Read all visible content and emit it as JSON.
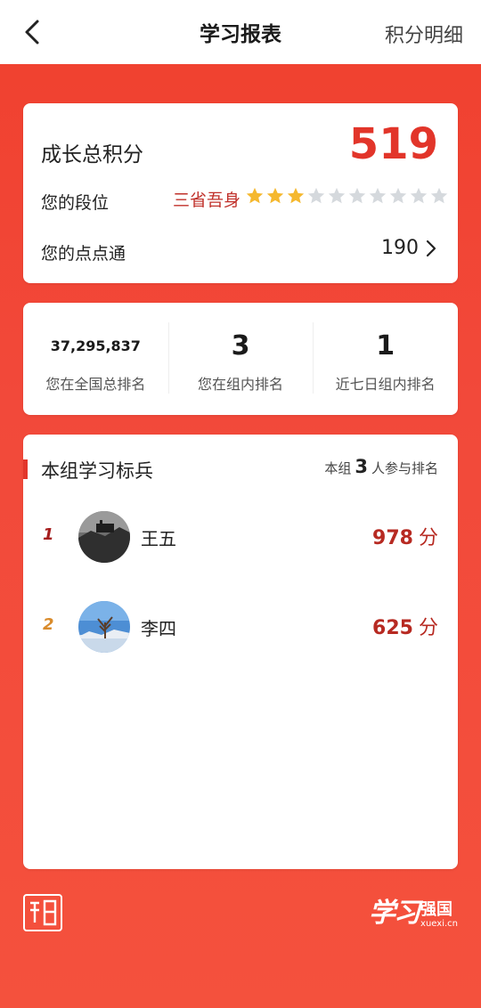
{
  "header": {
    "title": "学习报表",
    "detail_link": "积分明细"
  },
  "summary": {
    "total_label": "成长总积分",
    "total_value": "519",
    "rank_label": "您的段位",
    "rank_title": "三省吾身",
    "stars_filled": 3,
    "stars_total": 10,
    "points_label": "您的点点通",
    "points_value": "190"
  },
  "rankings": [
    {
      "value": "37,295,837",
      "label": "您在全国总排名"
    },
    {
      "value": "3",
      "label": "您在组内排名"
    },
    {
      "value": "1",
      "label": "近七日组内排名"
    }
  ],
  "group": {
    "title": "本组学习标兵",
    "meta_prefix": "本组",
    "meta_count": "3",
    "meta_suffix": "人参与排名",
    "members": [
      {
        "rank": "1",
        "name": "王五",
        "score": "978",
        "unit": "分"
      },
      {
        "rank": "2",
        "name": "李四",
        "score": "625",
        "unit": "分"
      }
    ]
  },
  "brand": {
    "script_text": "学习",
    "name": "强国",
    "url": "xuexi.cn"
  },
  "colors": {
    "accent": "#e2352a",
    "background": "#f2493a",
    "score": "#b72a22",
    "star_filled": "#f5b82e",
    "star_empty": "#d5d9dd",
    "rank1": "#a51d1d",
    "rank2": "#d98b2b"
  }
}
